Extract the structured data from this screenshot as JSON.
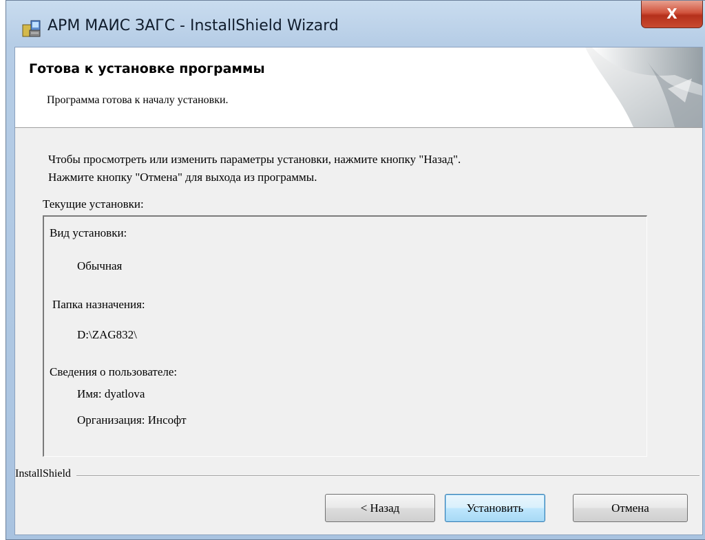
{
  "window": {
    "title": "АРМ МАИС ЗАГС - InstallShield Wizard",
    "close_label": "X"
  },
  "header": {
    "title": "Готова к установке программы",
    "subtitle": "Программа готова к началу установки."
  },
  "instructions": {
    "line1": "Чтобы просмотреть или изменить параметры установки, нажмите кнопку \"Назад\".",
    "line2": "Нажмите кнопку \"Отмена\" для выхода из программы."
  },
  "current_settings": {
    "label": "Текущие установки:",
    "setup_type_label": "Вид установки:",
    "setup_type_value": "Обычная",
    "destination_label": "Папка назначения:",
    "destination_value": "D:\\ZAG832\\",
    "user_info_label": "Сведения о пользователе:",
    "user_name": "Имя: dyatlova",
    "organization": "Организация: Инсофт"
  },
  "footer": {
    "brand": "InstallShield",
    "back_label": "< Назад",
    "install_label": "Установить",
    "cancel_label": "Отмена"
  },
  "colors": {
    "close_button": "#c84a30",
    "default_button_border": "#3c7fb1",
    "dialog_background": "#f0f0f0"
  }
}
